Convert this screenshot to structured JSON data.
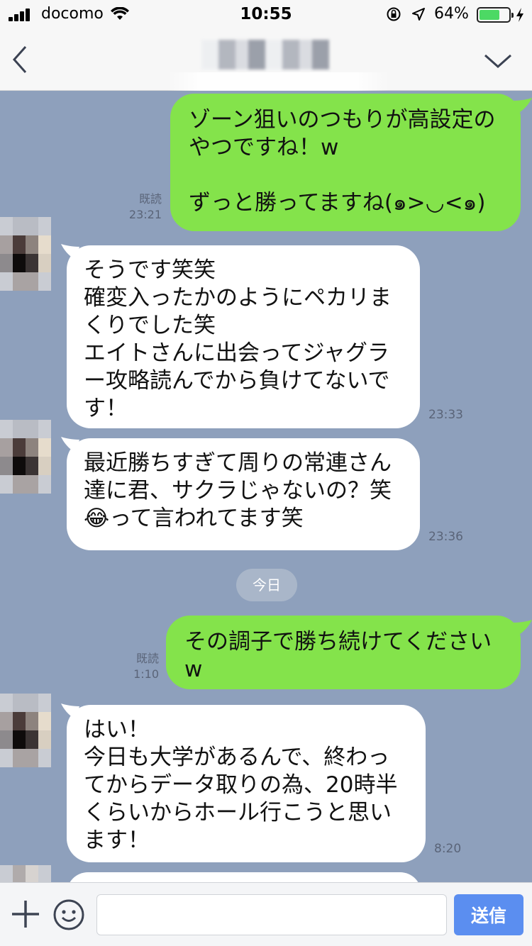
{
  "status_bar": {
    "carrier": "docomo",
    "time": "10:55",
    "battery_percent": "64%"
  },
  "nav": {
    "back_icon": "chevron-left-icon",
    "menu_icon": "chevron-down-icon"
  },
  "messages": [
    {
      "direction": "out",
      "text": "ゾーン狙いのつもりが高設定の\nやつですね！w\n\nずっと勝ってますね(๑>◡<๑)",
      "read": "既読",
      "time": "23:21"
    },
    {
      "direction": "in",
      "text": "そうです笑笑\n確変入ったかのようにペカリま\nくりでした笑\nエイトさんに出会ってジャグラ\nー攻略読んでから負けてないで\nす！",
      "time": "23:33"
    },
    {
      "direction": "in",
      "text": "最近勝ちすぎて周りの常連さん\n達に君、サクラじゃないの？笑\n😂って言われてます笑",
      "time": "23:36"
    },
    {
      "direction": "out",
      "text": "その調子で勝ち続けてください\nw",
      "read": "既読",
      "time": "1:10"
    },
    {
      "direction": "in",
      "text": "はい！\n今日も大学があるんで、終わっ\nてからデータ取りの為、20時半\nくらいからホール行こうと思い\nます！",
      "time": "8:20"
    }
  ],
  "date_separator": "今日",
  "input_bar": {
    "placeholder": "",
    "send_label": "送信"
  }
}
